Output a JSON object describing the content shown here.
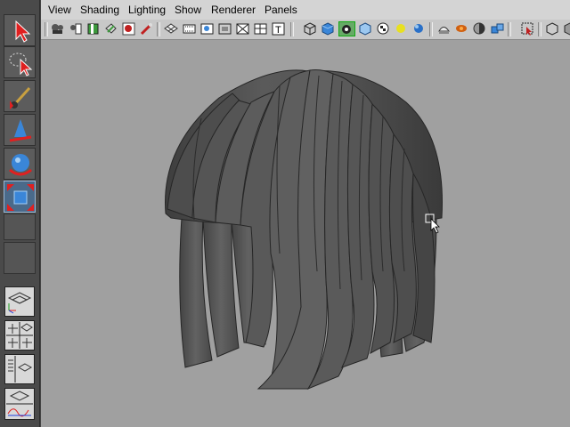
{
  "menu": {
    "view": "View",
    "shading": "Shading",
    "lighting": "Lighting",
    "show": "Show",
    "renderer": "Renderer",
    "panels": "Panels"
  },
  "icons": {
    "toolbox": [
      "select-arrow-icon",
      "lasso-select-icon",
      "paint-select-icon",
      "move-tool-icon",
      "rotate-tool-icon",
      "scale-tool-icon"
    ],
    "layouts": [
      "single-perspective-layout-icon",
      "four-view-layout-icon",
      "outliner-persp-layout-icon",
      "graph-persp-layout-icon"
    ],
    "shelf": [
      "camera-attributes-icon",
      "bookmark-icon",
      "image-plane-icon",
      "two-d-pan-icon",
      "grease-pencil-icon",
      "camera-select-icon",
      "grid-icon",
      "film-gate-icon",
      "resolution-gate-icon",
      "gate-mask-icon",
      "field-chart-icon",
      "safe-action-icon",
      "safe-title-icon",
      "wireframe-icon",
      "smooth-shade-icon",
      "shade-wireframe-icon",
      "textured-icon",
      "use-all-lights-icon",
      "shadows-icon",
      "screen-space-ao-icon",
      "motion-blur-icon",
      "anti-alias-icon",
      "depth-of-field-icon",
      "isolate-select-icon",
      "xray-icon"
    ]
  },
  "colors": {
    "viewport_bg": "#a0a0a0",
    "menu_bg": "#d4d4d4",
    "hair_fill": "#4f4f4f",
    "hair_highlight": "#6a6a6a",
    "hair_edge": "#262626",
    "active_tool": "#4a6a8a"
  }
}
